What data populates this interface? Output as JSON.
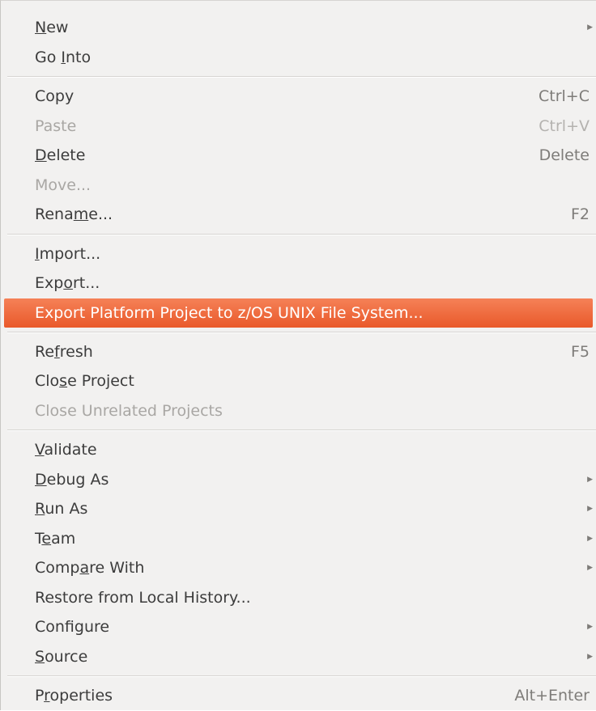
{
  "menu": {
    "new": {
      "pre": "",
      "u": "N",
      "post": "ew"
    },
    "go_into": {
      "pre": "Go ",
      "u": "I",
      "post": "nto"
    },
    "copy": {
      "pre": "Copy",
      "u": "",
      "post": "",
      "shortcut": "Ctrl+C"
    },
    "paste": {
      "pre": "Paste",
      "u": "",
      "post": "",
      "shortcut": "Ctrl+V"
    },
    "delete": {
      "pre": "",
      "u": "D",
      "post": "elete",
      "shortcut": "Delete"
    },
    "move": {
      "pre": "Move...",
      "u": "",
      "post": ""
    },
    "rename": {
      "pre": "Rena",
      "u": "m",
      "post": "e...",
      "shortcut": "F2"
    },
    "import": {
      "pre": "",
      "u": "I",
      "post": "mport..."
    },
    "export": {
      "pre": "Exp",
      "u": "o",
      "post": "rt..."
    },
    "export_platform": {
      "pre": "Export Platform Project to z/OS UNIX File System...",
      "u": "",
      "post": ""
    },
    "refresh": {
      "pre": "Re",
      "u": "f",
      "post": "resh",
      "shortcut": "F5"
    },
    "close_project": {
      "pre": "Clo",
      "u": "s",
      "post": "e Project"
    },
    "close_unrelated": {
      "pre": "Close Unrelated Projects",
      "u": "",
      "post": ""
    },
    "validate": {
      "pre": "",
      "u": "V",
      "post": "alidate"
    },
    "debug_as": {
      "pre": "",
      "u": "D",
      "post": "ebug As"
    },
    "run_as": {
      "pre": "",
      "u": "R",
      "post": "un As"
    },
    "team": {
      "pre": "T",
      "u": "e",
      "post": "am"
    },
    "compare_with": {
      "pre": "Comp",
      "u": "a",
      "post": "re With"
    },
    "restore": {
      "pre": "Restore from Local History...",
      "u": "",
      "post": ""
    },
    "configure": {
      "pre": "Configure",
      "u": "",
      "post": ""
    },
    "source": {
      "pre": "",
      "u": "S",
      "post": "ource"
    },
    "properties": {
      "pre": "P",
      "u": "r",
      "post": "operties",
      "shortcut": "Alt+Enter"
    }
  },
  "icons": {
    "submenu": "submenu-arrow-icon"
  },
  "colors": {
    "highlight": "#e95a2b",
    "background": "#f2f1f0",
    "disabled": "#a9a7a4"
  }
}
